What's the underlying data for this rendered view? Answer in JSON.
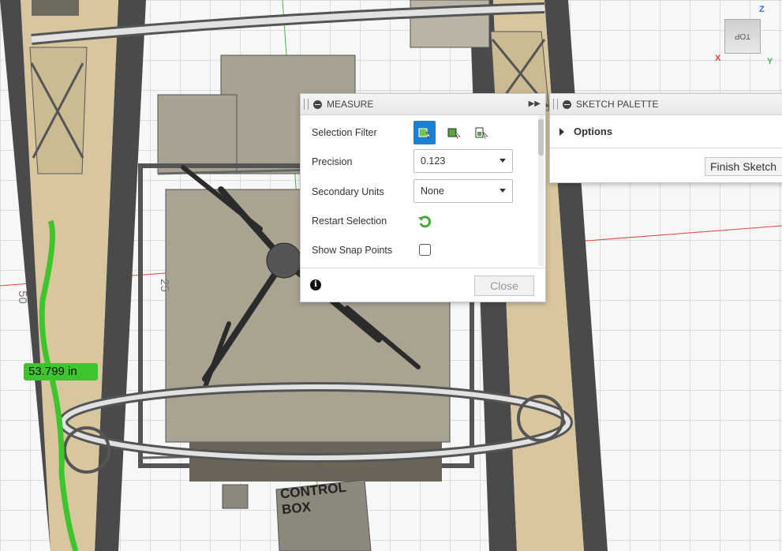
{
  "viewport": {
    "dimension_value": "53.799 in",
    "sketch_dims": [
      "50",
      "25"
    ],
    "control_box": [
      "CONTROL",
      "BOX"
    ]
  },
  "viewcube": {
    "face": "TOP",
    "axis_x": "X",
    "axis_y": "Y",
    "axis_z": "Z"
  },
  "measure": {
    "title": "MEASURE",
    "selection_filter_label": "Selection Filter",
    "filter_icons": [
      "select-face-icon",
      "select-body-icon",
      "select-component-icon"
    ],
    "precision_label": "Precision",
    "precision_value": "0.123",
    "secondary_units_label": "Secondary Units",
    "secondary_units_value": "None",
    "restart_selection_label": "Restart Selection",
    "show_snap_points_label": "Show Snap Points",
    "show_snap_points_checked": false,
    "close_label": "Close"
  },
  "sketch_palette": {
    "title": "SKETCH PALETTE",
    "options_label": "Options",
    "finish_label": "Finish Sketch"
  },
  "colors": {
    "accent": "#1d7fd0",
    "measure_highlight": "#3ec42c",
    "axis_red": "#e0453a",
    "axis_green": "#47b547"
  }
}
